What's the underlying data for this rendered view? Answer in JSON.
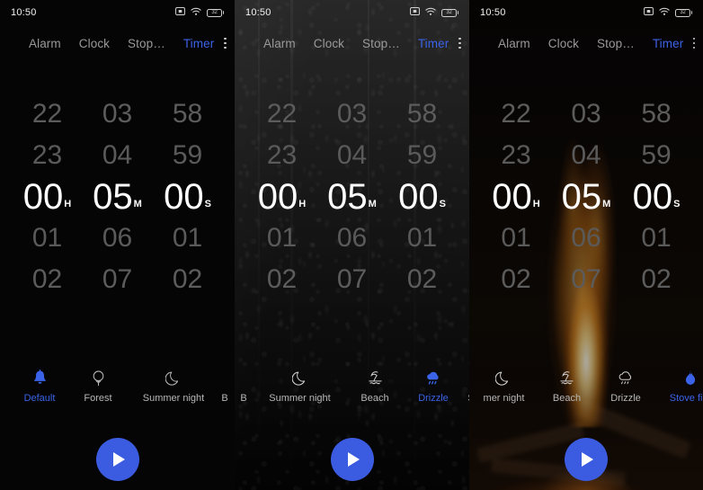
{
  "status_bar": {
    "time": "10:50",
    "icons": [
      "screenshot-icon",
      "wifi-icon",
      "battery-icon"
    ],
    "battery_level": "32"
  },
  "tabs": [
    {
      "label": "Alarm",
      "active": false
    },
    {
      "label": "Clock",
      "active": false
    },
    {
      "label": "Stop…",
      "active": false
    },
    {
      "label": "Timer",
      "active": true
    }
  ],
  "overflow_menu_label": "More options",
  "picker": {
    "hours": {
      "above2": "22",
      "above1": "23",
      "selected": "00",
      "below1": "01",
      "below2": "02",
      "unit": "H"
    },
    "minutes": {
      "above2": "03",
      "above1": "04",
      "selected": "05",
      "below1": "06",
      "below2": "07",
      "unit": "M"
    },
    "seconds": {
      "above2": "58",
      "above1": "59",
      "selected": "00",
      "below1": "01",
      "below2": "02",
      "unit": "S"
    }
  },
  "panels": [
    {
      "name": "default-theme-panel",
      "background": "plain-black",
      "sounds": [
        {
          "label": "Default",
          "icon": "bell-icon",
          "active": true
        },
        {
          "label": "Forest",
          "icon": "tree-icon",
          "active": false
        },
        {
          "label": "Summer night",
          "icon": "moon-icon",
          "active": false
        },
        {
          "label": "B",
          "icon": "beach-icon",
          "active": false
        }
      ]
    },
    {
      "name": "drizzle-theme-panel",
      "background": "rain-window",
      "sounds": [
        {
          "label": "B",
          "icon": "beach-icon",
          "active": false
        },
        {
          "label": "Summer night",
          "icon": "moon-icon",
          "active": false
        },
        {
          "label": "Beach",
          "icon": "beach-icon",
          "active": false
        },
        {
          "label": "Drizzle",
          "icon": "rain-cloud-icon",
          "active": true
        },
        {
          "label": "S",
          "icon": "flame-icon",
          "active": false
        }
      ]
    },
    {
      "name": "stove-fire-theme-panel",
      "background": "camp-fire",
      "sounds": [
        {
          "label": " mer night",
          "icon": "moon-icon",
          "active": false
        },
        {
          "label": "Beach",
          "icon": "beach-icon",
          "active": false
        },
        {
          "label": "Drizzle",
          "icon": "rain-cloud-icon",
          "active": false
        },
        {
          "label": "Stove fire",
          "icon": "flame-icon",
          "active": true
        }
      ]
    }
  ],
  "play_button_label": "Start timer",
  "colors": {
    "accent": "#3b63e8",
    "play_button": "#3b5ce0",
    "selected_digit": "#ffffff",
    "dim_digit": "#5c5c5c",
    "label": "#b7b7b7"
  }
}
